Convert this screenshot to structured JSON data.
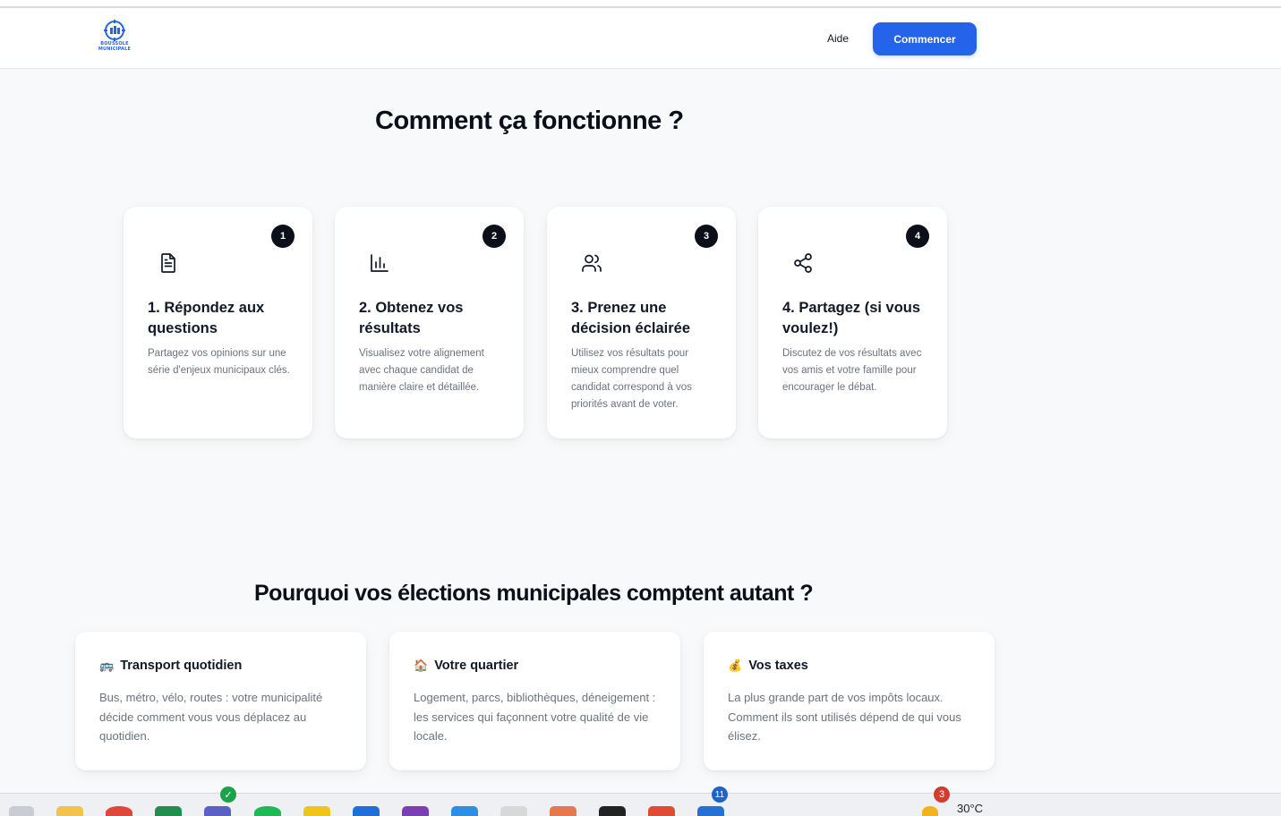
{
  "app": {
    "logo_line1": "BOUSSOLE",
    "logo_line2": "MUNICIPALE",
    "nav_help": "Aide",
    "cta": "Commencer"
  },
  "how": {
    "title": "Comment ça fonctionne ?",
    "steps": [
      {
        "number": "1",
        "icon": "document-icon",
        "title": "1. Répondez aux questions",
        "desc": "Partagez vos opinions sur une série d'enjeux municipaux clés."
      },
      {
        "number": "2",
        "icon": "bar-chart-icon",
        "title": "2. Obtenez vos résultats",
        "desc": "Visualisez votre alignement avec chaque candidat de manière claire et détaillée."
      },
      {
        "number": "3",
        "icon": "users-icon",
        "title": "3. Prenez une décision éclairée",
        "desc": "Utilisez vos résultats pour mieux comprendre quel candidat correspond à vos priorités avant de voter."
      },
      {
        "number": "4",
        "icon": "share-icon",
        "title": "4. Partagez (si vous voulez!)",
        "desc": "Discutez de vos résultats avec vos amis et votre famille pour encourager le débat."
      }
    ]
  },
  "why": {
    "title": "Pourquoi vos élections municipales comptent autant ?",
    "cards": [
      {
        "emoji": "🚌",
        "title": "Transport quotidien",
        "desc": "Bus, métro, vélo, routes : votre municipalité décide comment vous vous déplacez au quotidien."
      },
      {
        "emoji": "🏠",
        "title": "Votre quartier",
        "desc": "Logement, parcs, bibliothèques, déneigement : les services qui façonnent votre qualité de vie locale."
      },
      {
        "emoji": "💰",
        "title": "Vos taxes",
        "desc": "La plus grande part de vos impôts locaux. Comment ils sont utilisés dépend de qui vous élisez."
      }
    ]
  },
  "taskbar": {
    "weather_badge": "3",
    "weather_temp": "30°C",
    "mail_badge": "11"
  },
  "colors": {
    "accent": "#2563eb",
    "badge": "#0b0f19",
    "muted_text": "#6b7280",
    "page_bg": "#f8f9fb"
  }
}
